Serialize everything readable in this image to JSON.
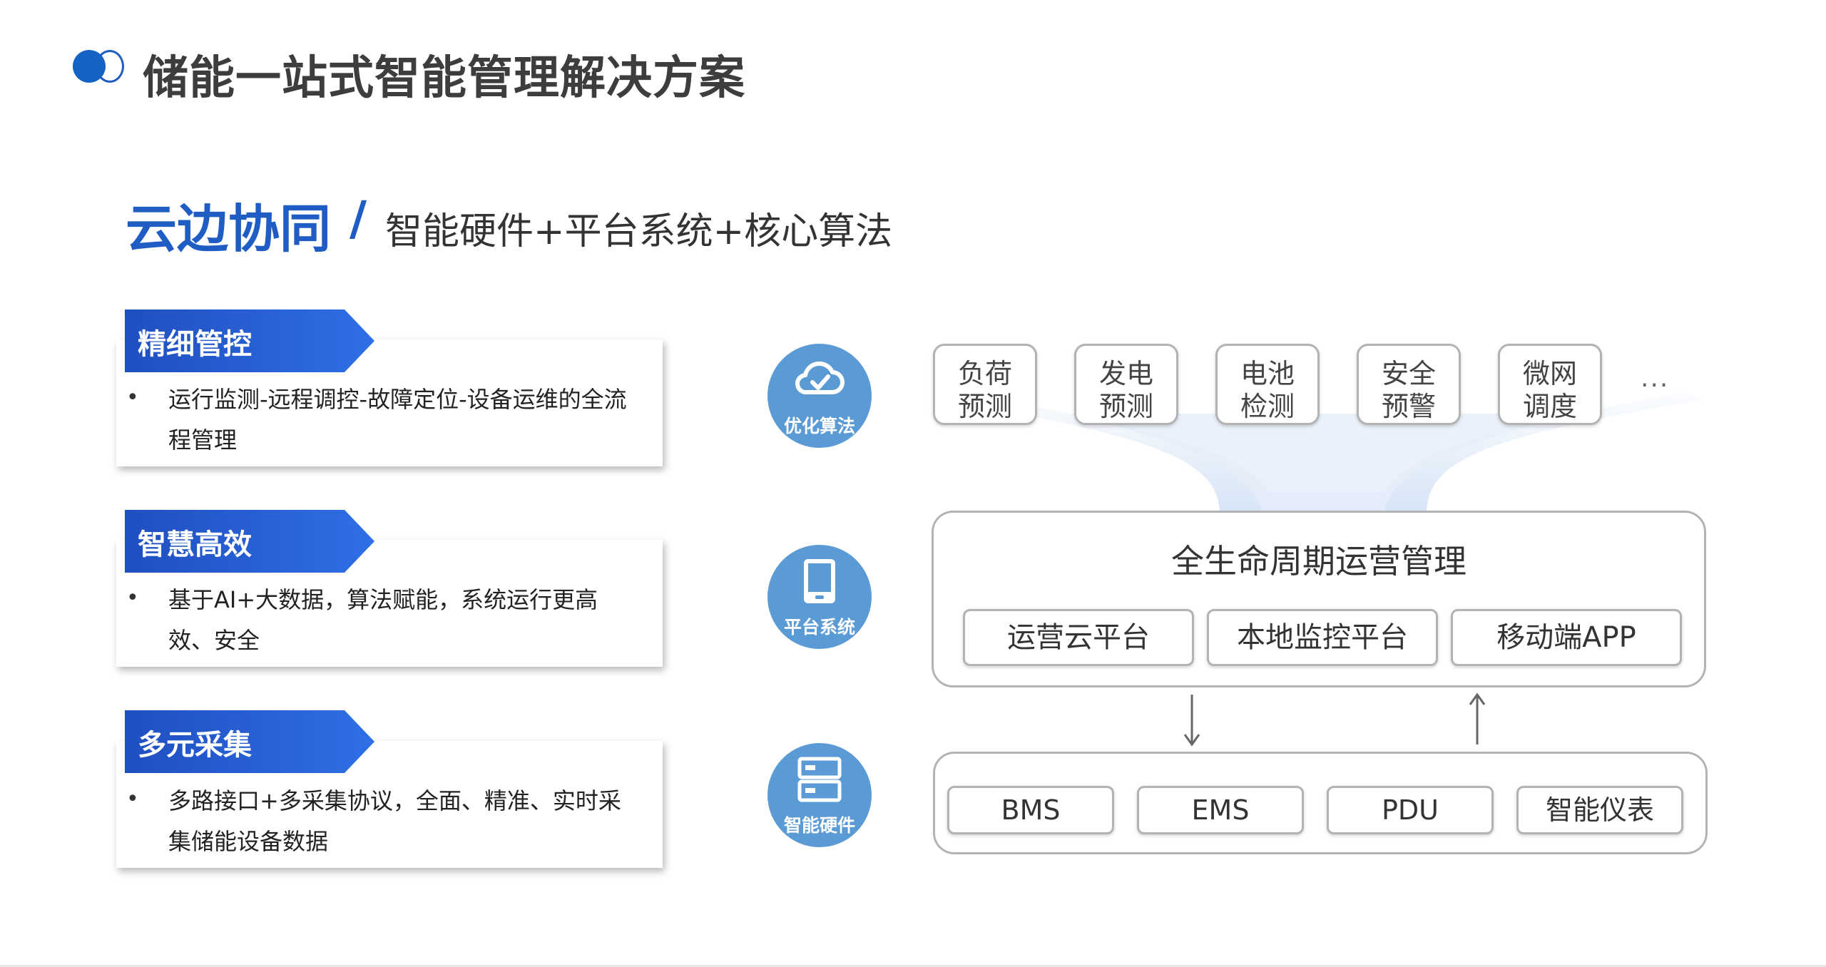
{
  "header": {
    "title": "储能一站式智能管理解决方案"
  },
  "subtitle": {
    "main": "云边协同",
    "slash": "/",
    "rest": "智能硬件+平台系统+核心算法"
  },
  "features": [
    {
      "tag": "精细管控",
      "bullet": "•",
      "text": "运行监测-远程调控-故障定位-设备运维的全流程管理"
    },
    {
      "tag": "智慧高效",
      "bullet": "•",
      "text": "基于AI+大数据，算法赋能，系统运行更高效、安全"
    },
    {
      "tag": "多元采集",
      "bullet": "•",
      "text": "多路接口+多采集协议，全面、精准、实时采集储能设备数据"
    }
  ],
  "layers": [
    {
      "label": "优化算法",
      "icon": "cloud-check-icon"
    },
    {
      "label": "平台系统",
      "icon": "tablet-icon"
    },
    {
      "label": "智能硬件",
      "icon": "server-icon"
    }
  ],
  "algorithms": [
    {
      "line1": "负荷",
      "line2": "预测"
    },
    {
      "line1": "发电",
      "line2": "预测"
    },
    {
      "line1": "电池",
      "line2": "检测"
    },
    {
      "line1": "安全",
      "line2": "预警"
    },
    {
      "line1": "微网",
      "line2": "调度"
    }
  ],
  "algorithms_more": "...",
  "platform": {
    "title": "全生命周期运营管理",
    "items": [
      "运营云平台",
      "本地监控平台",
      "移动端APP"
    ]
  },
  "hardware": {
    "items": [
      "BMS",
      "EMS",
      "PDU",
      "智能仪表"
    ]
  },
  "colors": {
    "accent_blue": "#1f5cc4",
    "tag_gradient_start": "#1f4fc0",
    "tag_gradient_end": "#2f6fe6",
    "circle_blue": "#5b9bd5",
    "border_gray": "#b3b3b3"
  }
}
